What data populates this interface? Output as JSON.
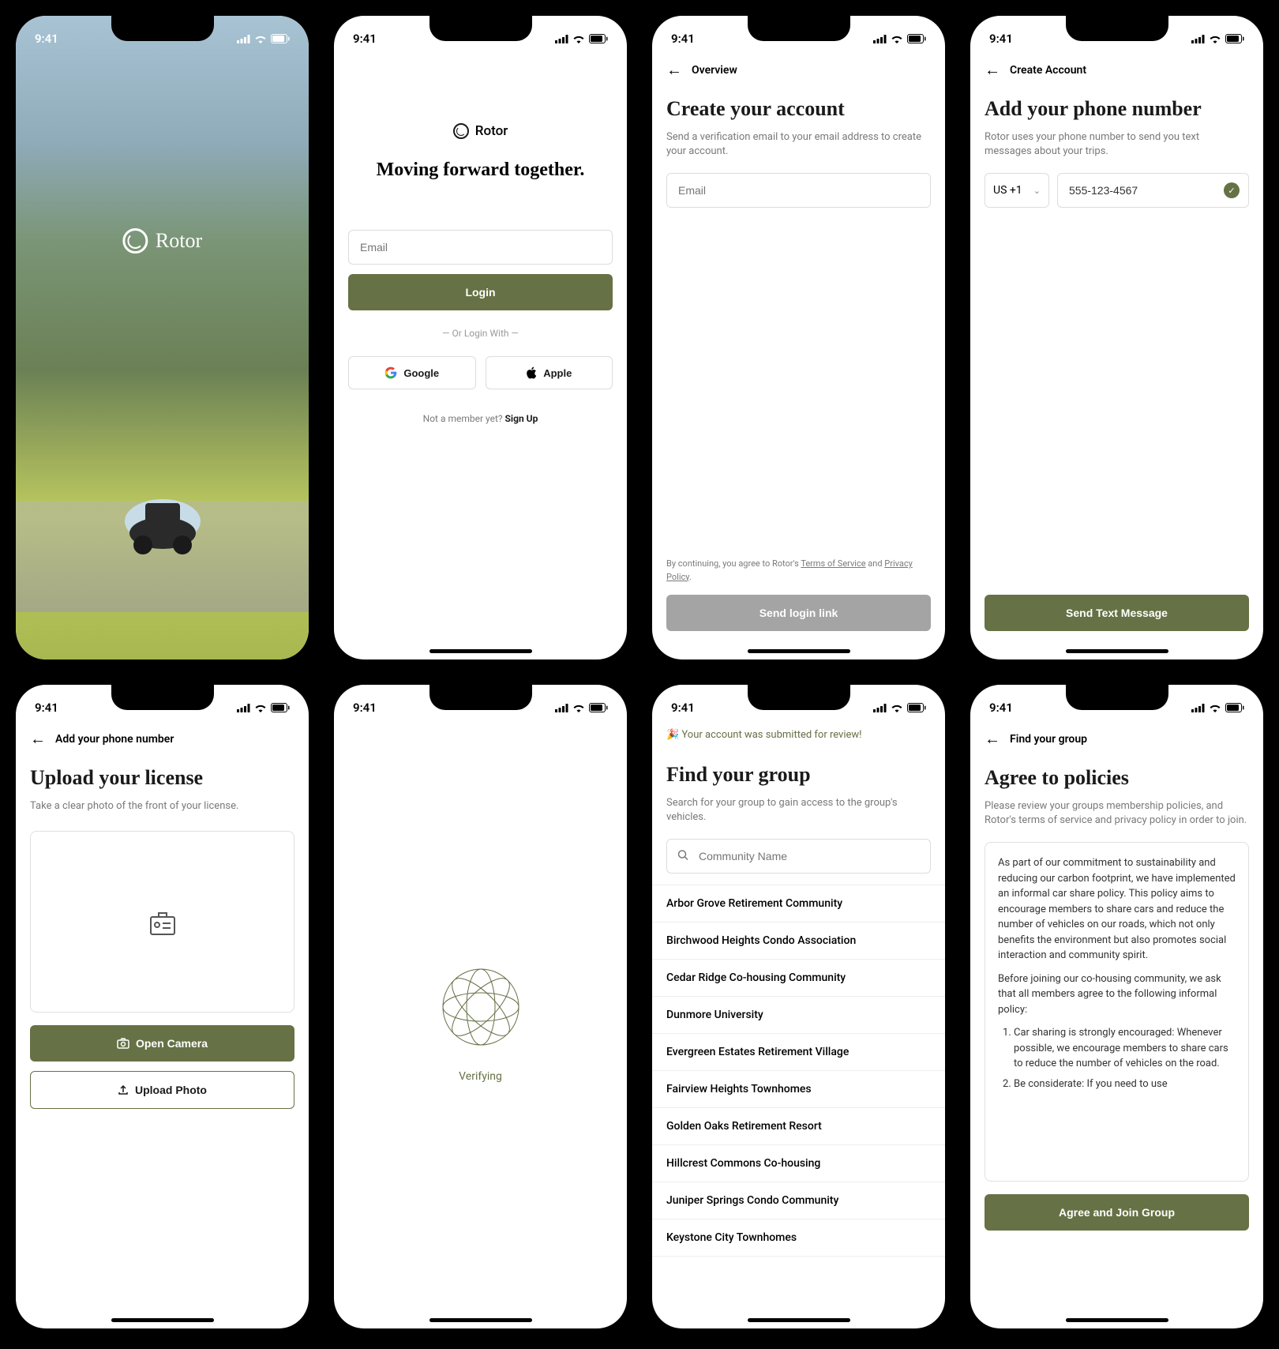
{
  "status": {
    "time": "9:41"
  },
  "brand": {
    "name": "Rotor",
    "accent": "#667145"
  },
  "screen1": {},
  "screen2": {
    "tagline": "Moving forward together.",
    "email_placeholder": "Email",
    "login_label": "Login",
    "divider": "— Or Login With —",
    "google_label": "Google",
    "apple_label": "Apple",
    "not_member": "Not a member yet? ",
    "signup": "Sign Up"
  },
  "screen3": {
    "nav": "Overview",
    "title": "Create your account",
    "subtitle": "Send a verification email to your email address to create your account.",
    "email_placeholder": "Email",
    "terms_prefix": "By continuing, you agree to Rotor's ",
    "terms": "Terms of Service",
    "and": " and ",
    "privacy": "Privacy Policy",
    "button": "Send login link"
  },
  "screen4": {
    "nav": "Create Account",
    "title": "Add your phone number",
    "subtitle": "Rotor uses your phone number to send you text messages about your trips.",
    "country": "US +1",
    "phone_value": "555-123-4567",
    "button": "Send Text Message"
  },
  "screen5": {
    "nav": "Add your phone number",
    "title": "Upload your license",
    "subtitle": "Take a clear photo of the front of your license.",
    "camera_label": "Open Camera",
    "upload_label": "Upload Photo"
  },
  "screen6": {
    "status": "Verifying"
  },
  "screen7": {
    "banner": "🎉 Your account was submitted for review!",
    "title": "Find your group",
    "subtitle": "Search for your group to gain access to the group's vehicles.",
    "search_placeholder": "Community Name",
    "items": [
      "Arbor Grove Retirement Community",
      "Birchwood Heights Condo Association",
      "Cedar Ridge Co-housing Community",
      "Dunmore University",
      "Evergreen Estates Retirement Village",
      "Fairview Heights Townhomes",
      "Golden Oaks Retirement Resort",
      "Hillcrest Commons Co-housing",
      "Juniper Springs Condo Community",
      "Keystone City Townhomes"
    ]
  },
  "screen8": {
    "nav": "Find your group",
    "title": "Agree to policies",
    "subtitle": "Please review your groups membership policies, and Rotor's terms of service and privacy policy in order to join.",
    "policy_p1": "As part of our commitment to sustainability and reducing our carbon footprint, we have implemented an informal car share policy. This policy aims to encourage members to share cars and reduce the number of vehicles on our roads, which not only benefits the environment but also promotes social interaction and community spirit.",
    "policy_p2": "Before joining our co-housing community, we ask that all members agree to the following informal policy:",
    "policy_li1": "Car sharing is strongly encouraged: Whenever possible, we encourage members to share cars to reduce the number of vehicles on the road.",
    "policy_li2": "Be considerate: If you need to use",
    "button": "Agree and Join Group"
  }
}
